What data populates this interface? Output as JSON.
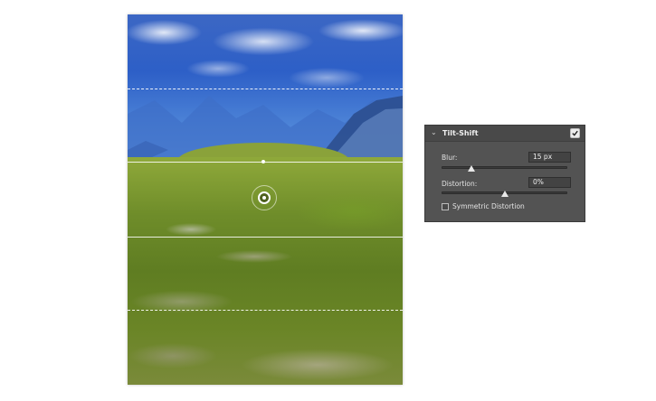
{
  "panel": {
    "title": "Tilt-Shift",
    "enabled": true,
    "blur": {
      "label": "Blur:",
      "value": "15 px",
      "slider_fraction": 0.24
    },
    "distortion": {
      "label": "Distortion:",
      "value": "0%",
      "slider_fraction": 0.5
    },
    "symmetric": {
      "label": "Symmetric Distortion",
      "checked": false
    }
  },
  "colors": {
    "panel_bg": "#535353",
    "header_bg": "#494949",
    "sky": "#2d5fc7",
    "grass": "#6f8d2a"
  }
}
